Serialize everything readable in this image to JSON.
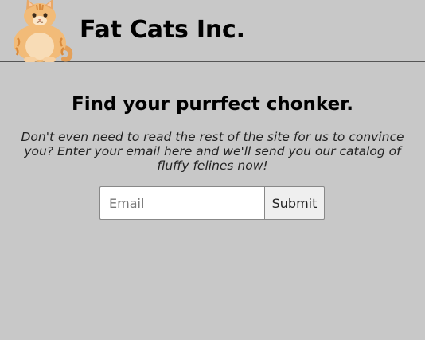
{
  "header": {
    "brand": "Fat Cats Inc.",
    "logo_icon": "fat-cat-logo"
  },
  "hero": {
    "title": "Find your purrfect chonker.",
    "subtitle": "Don't even need to read the rest of the site for us to convince you? Enter your email here and we'll send you our catalog of fluffy felines now!"
  },
  "form": {
    "email_placeholder": "Email",
    "email_value": "",
    "submit_label": "Submit"
  },
  "colors": {
    "background": "#c8c8c8",
    "cat_fur": "#f0b46a",
    "cat_stripes": "#d98a3c"
  }
}
